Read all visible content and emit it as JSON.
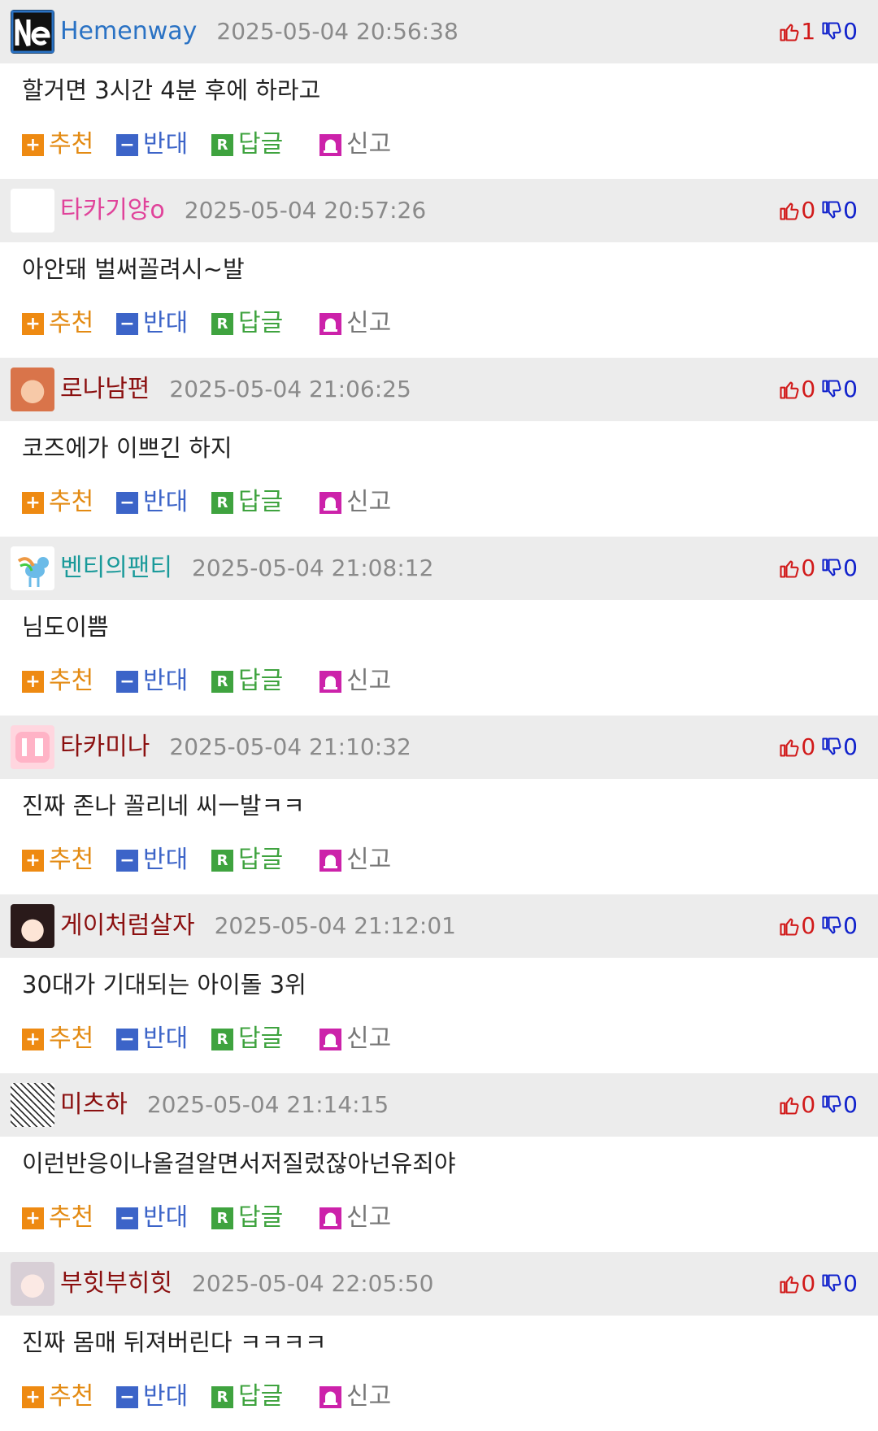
{
  "actions": {
    "recommend": "추천",
    "oppose": "반대",
    "reply": "답글",
    "report": "신고"
  },
  "icons": {
    "recommend": "plus-icon",
    "oppose": "minus-icon",
    "reply": "reply-r-icon",
    "report": "siren-icon",
    "like": "thumbs-up-icon",
    "dislike": "thumbs-down-icon"
  },
  "colors": {
    "header_bg": "#ececec",
    "recommend": "#e38a12",
    "oppose": "#3c64c8",
    "reply": "#3fa33f",
    "report": "#cc22aa",
    "like_count": "#d11a1a",
    "dislike_count": "#1122cc"
  },
  "comments": [
    {
      "nickname": "Hemenway",
      "nick_color": "#2a72c4",
      "datetime": "2025-05-04 20:56:38",
      "likes": "1",
      "dislikes": "0",
      "text": "할거면 3시간 4분 후에 하라고",
      "avatar": "logo-ne-avatar"
    },
    {
      "nickname": "타카기양o",
      "nick_color": "#e0439a",
      "datetime": "2025-05-04 20:57:26",
      "likes": "0",
      "dislikes": "0",
      "text": "아안돼 벌써꼴려시~발",
      "avatar": "blank-avatar"
    },
    {
      "nickname": "로나남편",
      "nick_color": "#8b1010",
      "datetime": "2025-05-04 21:06:25",
      "likes": "0",
      "dislikes": "0",
      "text": "코즈에가 이쁘긴 하지",
      "avatar": "anime-girl-avatar"
    },
    {
      "nickname": "벤티의팬티",
      "nick_color": "#1a9a9a",
      "datetime": "2025-05-04 21:08:12",
      "likes": "0",
      "dislikes": "0",
      "text": "님도이쁨",
      "avatar": "pony-avatar"
    },
    {
      "nickname": "타카미나",
      "nick_color": "#8b1010",
      "datetime": "2025-05-04 21:10:32",
      "likes": "0",
      "dislikes": "0",
      "text": "진짜 존나 꼴리네 씨ㅡ발ㅋㅋ",
      "avatar": "pink-avatar"
    },
    {
      "nickname": "게이처럼살자",
      "nick_color": "#8b1010",
      "datetime": "2025-05-04 21:12:01",
      "likes": "0",
      "dislikes": "0",
      "text": "30대가 기대되는 아이돌 3위",
      "avatar": "chibi-avatar"
    },
    {
      "nickname": "미츠하",
      "nick_color": "#8b1010",
      "datetime": "2025-05-04 21:14:15",
      "likes": "0",
      "dislikes": "0",
      "text": "이런반응이나올걸알면서저질렀잖아넌유죄야",
      "avatar": "manga-avatar"
    },
    {
      "nickname": "부힛부히힛",
      "nick_color": "#8b1010",
      "datetime": "2025-05-04 22:05:50",
      "likes": "0",
      "dislikes": "0",
      "text": "진짜 몸매 뒤져버린다 ㅋㅋㅋㅋ",
      "avatar": "sketch-girl-avatar"
    }
  ]
}
